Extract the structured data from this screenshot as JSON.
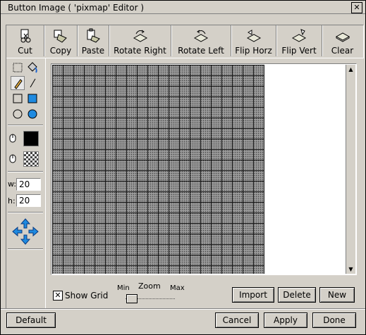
{
  "window": {
    "title": "Button Image ( 'pixmap' Editor )",
    "close_glyph": "✕"
  },
  "toolbar": {
    "items": [
      {
        "label": "Cut",
        "icon": "scissors-icon"
      },
      {
        "label": "Copy",
        "icon": "copy-icon"
      },
      {
        "label": "Paste",
        "icon": "paste-icon"
      },
      {
        "label": "Rotate Right",
        "icon": "rotate-right-icon"
      },
      {
        "label": "Rotate Left",
        "icon": "rotate-left-icon"
      },
      {
        "label": "Flip Horz",
        "icon": "flip-horizontal-icon"
      },
      {
        "label": "Flip Vert",
        "icon": "flip-vertical-icon"
      },
      {
        "label": "Clear",
        "icon": "eraser-icon"
      }
    ]
  },
  "tools": {
    "items": [
      "select-rect-tool",
      "fill-bucket-tool",
      "pencil-tool",
      "line-tool",
      "rectangle-outline-tool",
      "rectangle-filled-tool",
      "ellipse-outline-tool",
      "ellipse-filled-tool"
    ],
    "selected": "pencil-tool"
  },
  "colors": {
    "left_button_color": "#000000",
    "right_button_color": "transparent"
  },
  "size": {
    "w_label": "w:",
    "w_value": "20",
    "h_label": "h:",
    "h_value": "20"
  },
  "options": {
    "show_grid_label": "Show Grid",
    "show_grid_checked": true,
    "check_glyph": "✕",
    "zoom_label": "Zoom",
    "zoom_min_label": "Min",
    "zoom_max_label": "Max",
    "zoom_level": 0.1
  },
  "buttons": {
    "import": "Import",
    "delete": "Delete",
    "new": "New",
    "default": "Default",
    "cancel": "Cancel",
    "apply": "Apply",
    "done": "Done"
  }
}
